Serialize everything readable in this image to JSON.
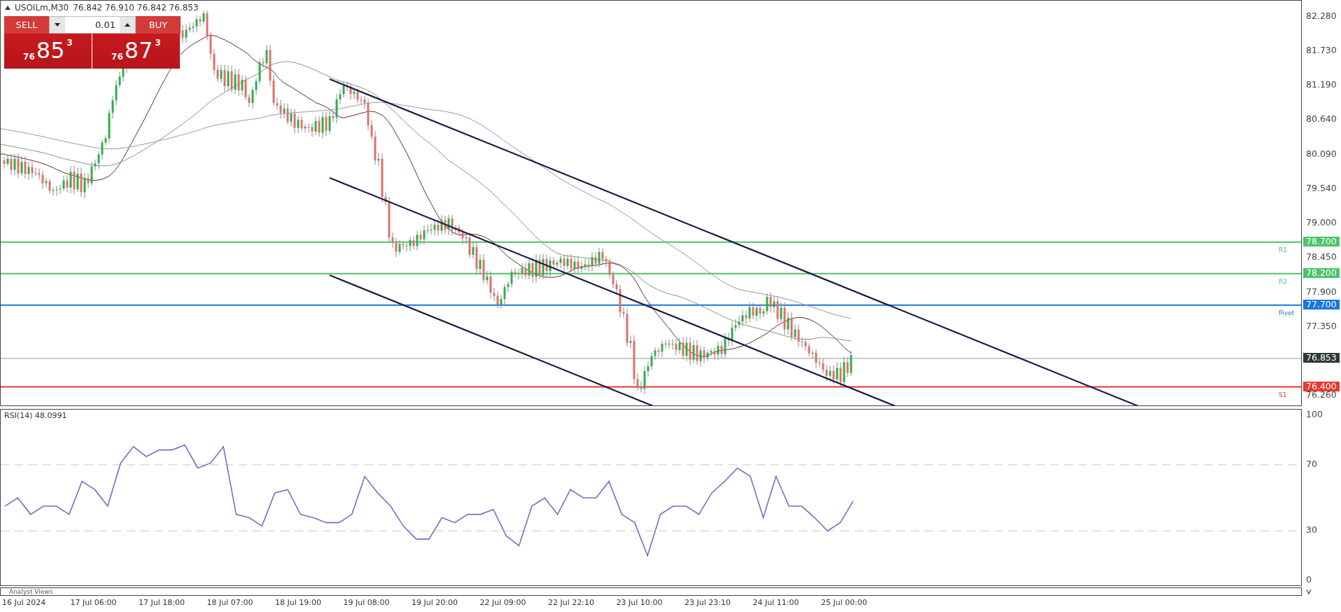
{
  "header": {
    "symbol": "USOILm,M30",
    "ohlc": "76.842 76.910 76.842 76.853"
  },
  "trade_panel": {
    "sell_label": "SELL",
    "buy_label": "BUY",
    "lot": "0.01",
    "sell_price": {
      "prefix": "76",
      "main": "85",
      "suffix": "3"
    },
    "buy_price": {
      "prefix": "76",
      "main": "87",
      "suffix": "3"
    }
  },
  "price_axis": {
    "ticks": [
      "82.280",
      "81.730",
      "81.190",
      "80.640",
      "80.090",
      "79.540",
      "79.000",
      "78.450",
      "77.900",
      "77.350",
      "76.260"
    ]
  },
  "levels": [
    {
      "label": "R1",
      "price": "78.700",
      "color": "#4cc46a"
    },
    {
      "label": "R2",
      "price": "78.200",
      "color": "#4cc46a"
    },
    {
      "label": "Pivot",
      "price": "77.700",
      "color": "#1877e0"
    },
    {
      "label": "S1",
      "price": "76.400",
      "color": "#e8382e"
    }
  ],
  "current_price": "76.853",
  "rsi": {
    "chart_data": {
      "type": "line",
      "title": "RSI(14) 48.0991",
      "ylim": [
        -3,
        103.4
      ],
      "yticks": [
        0,
        30,
        70,
        100
      ],
      "series": [
        {
          "color": "#7a6cc4",
          "values": [
            45,
            50,
            40,
            45,
            45,
            40,
            60,
            55,
            45,
            71,
            81,
            75,
            79,
            79,
            82,
            68,
            71,
            81,
            40,
            38,
            33,
            53,
            55,
            40,
            38,
            35,
            35,
            40,
            63,
            53,
            45,
            33,
            25,
            25,
            38,
            35,
            40,
            40,
            43,
            27,
            21,
            45,
            50,
            40,
            55,
            50,
            50,
            60,
            40,
            35,
            15,
            40,
            45,
            45,
            40,
            53,
            60,
            68,
            63,
            38,
            63,
            45,
            45,
            38,
            30,
            35,
            48
          ]
        }
      ]
    }
  },
  "analyst_views": "Analyst Views",
  "time_axis": [
    "16 Jul 2024",
    "17 Jul 06:00",
    "17 Jul 18:00",
    "18 Jul 07:00",
    "18 Jul 19:00",
    "19 Jul 08:00",
    "19 Jul 20:00",
    "22 Jul 09:00",
    "22 Jul 22:10",
    "23 Jul 10:00",
    "23 Jul 23:10",
    "24 Jul 11:00",
    "25 Jul 00:00"
  ]
}
